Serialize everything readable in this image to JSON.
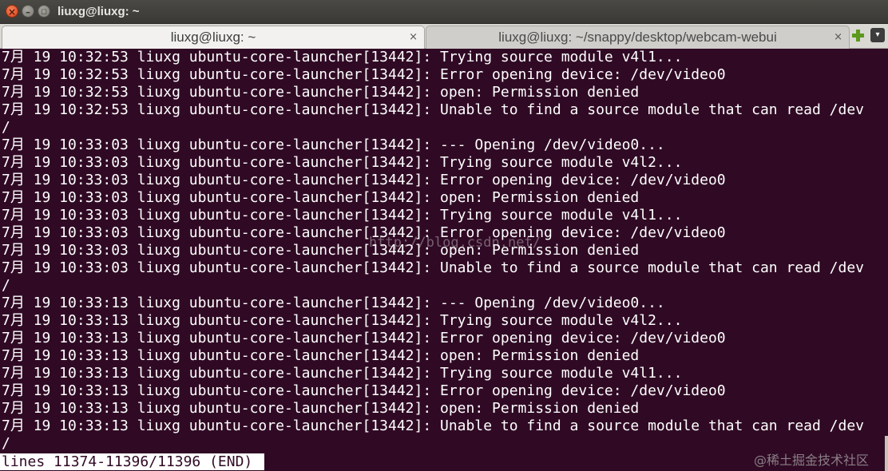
{
  "window": {
    "title": "liuxg@liuxg: ~",
    "close_glyph": "×",
    "minimize_glyph": "–",
    "maximize_glyph": "◻"
  },
  "tabs": [
    {
      "label": "liuxg@liuxg: ~",
      "active": true,
      "close": "×"
    },
    {
      "label": "liuxg@liuxg: ~/snappy/desktop/webcam-webui",
      "active": false,
      "close": "×"
    }
  ],
  "toolbar": {
    "new_tab_icon": "plus-icon",
    "tabs_menu_glyph": "▾"
  },
  "terminal": {
    "background": "#300a24",
    "foreground": "#ffffff",
    "lines": [
      "7月 19 10:32:53 liuxg ubuntu-core-launcher[13442]: Trying source module v4l1...",
      "7月 19 10:32:53 liuxg ubuntu-core-launcher[13442]: Error opening device: /dev/video0",
      "7月 19 10:32:53 liuxg ubuntu-core-launcher[13442]: open: Permission denied",
      "7月 19 10:32:53 liuxg ubuntu-core-launcher[13442]: Unable to find a source module that can read /dev",
      "/",
      "7月 19 10:33:03 liuxg ubuntu-core-launcher[13442]: --- Opening /dev/video0...",
      "7月 19 10:33:03 liuxg ubuntu-core-launcher[13442]: Trying source module v4l2...",
      "7月 19 10:33:03 liuxg ubuntu-core-launcher[13442]: Error opening device: /dev/video0",
      "7月 19 10:33:03 liuxg ubuntu-core-launcher[13442]: open: Permission denied",
      "7月 19 10:33:03 liuxg ubuntu-core-launcher[13442]: Trying source module v4l1...",
      "7月 19 10:33:03 liuxg ubuntu-core-launcher[13442]: Error opening device: /dev/video0",
      "7月 19 10:33:03 liuxg ubuntu-core-launcher[13442]: open: Permission denied",
      "7月 19 10:33:03 liuxg ubuntu-core-launcher[13442]: Unable to find a source module that can read /dev",
      "/",
      "7月 19 10:33:13 liuxg ubuntu-core-launcher[13442]: --- Opening /dev/video0...",
      "7月 19 10:33:13 liuxg ubuntu-core-launcher[13442]: Trying source module v4l2...",
      "7月 19 10:33:13 liuxg ubuntu-core-launcher[13442]: Error opening device: /dev/video0",
      "7月 19 10:33:13 liuxg ubuntu-core-launcher[13442]: open: Permission denied",
      "7月 19 10:33:13 liuxg ubuntu-core-launcher[13442]: Trying source module v4l1...",
      "7月 19 10:33:13 liuxg ubuntu-core-launcher[13442]: Error opening device: /dev/video0",
      "7月 19 10:33:13 liuxg ubuntu-core-launcher[13442]: open: Permission denied",
      "7月 19 10:33:13 liuxg ubuntu-core-launcher[13442]: Unable to find a source module that can read /dev",
      "/"
    ],
    "status": "lines 11374-11396/11396 (END)"
  },
  "overlay": {
    "url_watermark": "http://blog.csdn.net/",
    "site_watermark": "@稀土掘金技术社区"
  }
}
